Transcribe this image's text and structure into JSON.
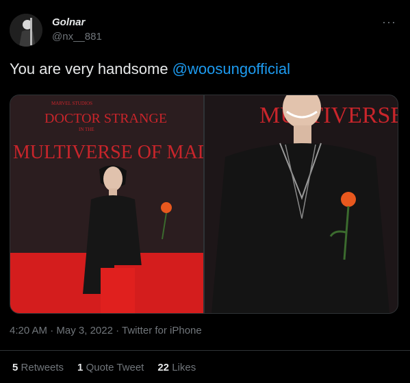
{
  "author": {
    "display_name": "Golnar",
    "handle": "@nx__881",
    "avatar_icon": "user-avatar"
  },
  "more_icon": "more-options-icon",
  "tweet": {
    "text": "You are very handsome ",
    "mention": "@woosungofficial"
  },
  "media": {
    "backdrop_text_top": "MARVEL STUDIOS",
    "backdrop_title": "DOCTOR STRANGE",
    "backdrop_in_the": "IN THE",
    "backdrop_subtitle": "MULTIVERSE OF MADNESS",
    "right_backdrop_text": "MULTIVERSE OF M"
  },
  "meta": {
    "time": "4:20 AM",
    "separator": " · ",
    "date": "May 3, 2022",
    "source": "Twitter for iPhone"
  },
  "stats": [
    {
      "count": "5",
      "label": "Retweets"
    },
    {
      "count": "1",
      "label": "Quote Tweet"
    },
    {
      "count": "22",
      "label": "Likes"
    }
  ],
  "colors": {
    "background": "#000000",
    "mention": "#1d9bf0",
    "secondary_text": "#71767b",
    "carpet_red": "#d41d1d"
  }
}
